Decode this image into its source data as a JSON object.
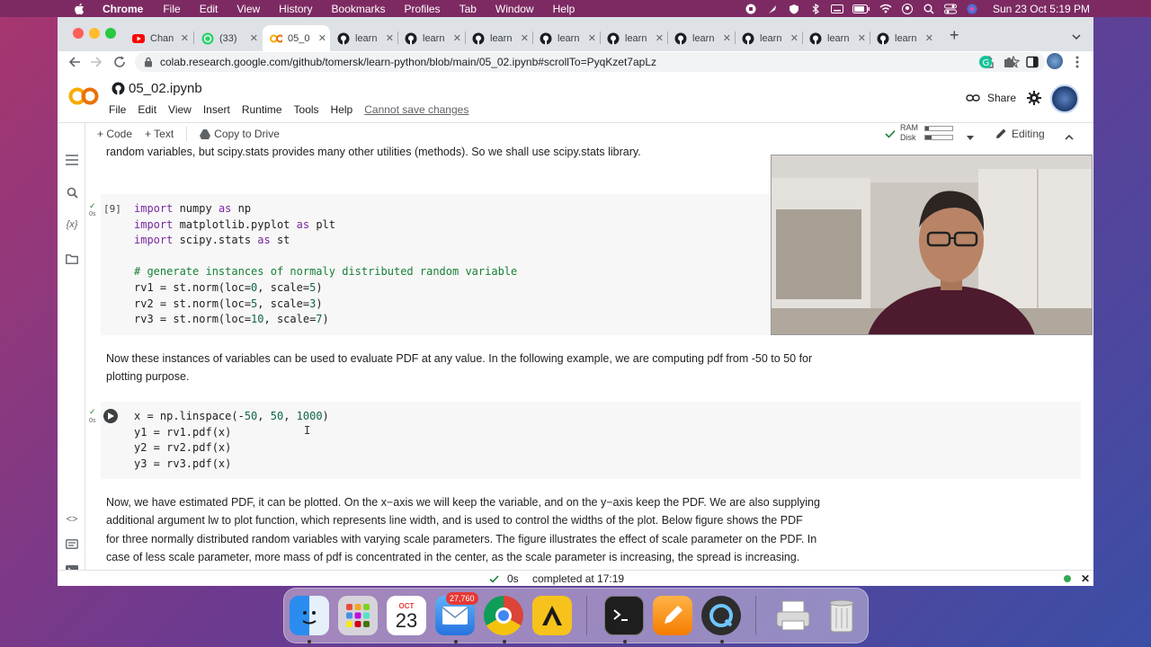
{
  "menubar": {
    "app": "Chrome",
    "items": [
      "File",
      "Edit",
      "View",
      "History",
      "Bookmarks",
      "Profiles",
      "Tab",
      "Window",
      "Help"
    ],
    "clock": "Sun 23 Oct  5:19 PM"
  },
  "tabs": [
    {
      "label": "Chan",
      "icon": "youtube-icon"
    },
    {
      "label": "(33)",
      "icon": "whatsapp-icon"
    },
    {
      "label": "05_0",
      "icon": "colab-icon"
    },
    {
      "label": "learn",
      "icon": "github-icon"
    },
    {
      "label": "learn",
      "icon": "github-icon"
    },
    {
      "label": "learn",
      "icon": "github-icon"
    },
    {
      "label": "learn",
      "icon": "github-icon"
    },
    {
      "label": "learn",
      "icon": "github-icon"
    },
    {
      "label": "learn",
      "icon": "github-icon"
    },
    {
      "label": "learn",
      "icon": "github-icon"
    },
    {
      "label": "learn",
      "icon": "github-icon"
    },
    {
      "label": "learn",
      "icon": "github-icon"
    }
  ],
  "url": "colab.research.google.com/github/tomersk/learn-python/blob/main/05_02.ipynb#scrollTo=PyqKzet7apLz",
  "notebook": {
    "title": "05_02.ipynb",
    "menu": [
      "File",
      "Edit",
      "View",
      "Insert",
      "Runtime",
      "Tools",
      "Help"
    ],
    "warning": "Cannot save changes",
    "share": "Share"
  },
  "toolbar": {
    "code": "+ Code",
    "text": "+ Text",
    "copy": "Copy to Drive",
    "ram": "RAM",
    "disk": "Disk",
    "editing": "Editing"
  },
  "cells": {
    "text1": "random variables, but scipy.stats provides many other utilities (methods). So we shall use scipy.stats library.",
    "exec_count": "[9]",
    "duration": "0s",
    "text2_line1": "Now these instances of variables can be used to evaluate PDF at any value. In the following example, we are computing pdf from -50 to 50 for",
    "text2_line2": "plotting purpose.",
    "text3_line1": "Now, we have estimated PDF, it can be plotted. On the x−axis we will keep the variable, and on the y−axis keep the PDF. We are also supplying",
    "text3_line2": "additional argument lw to plot function, which represents line width, and is used to control the widths of the plot. Below figure shows the PDF",
    "text3_line3": "for three normally distributed random variables with varying scale parameters. The figure illustrates the effect of scale parameter on the PDF. In",
    "text3_line4": "case of less scale parameter, more mass of pdf is concentrated in the center, as the scale parameter is increasing, the spread is increasing."
  },
  "status": {
    "time": "0s",
    "completed": "completed at 17:19"
  },
  "dock": {
    "calendar_month": "OCT",
    "calendar_day": "23",
    "mail_badge": "27,760"
  }
}
